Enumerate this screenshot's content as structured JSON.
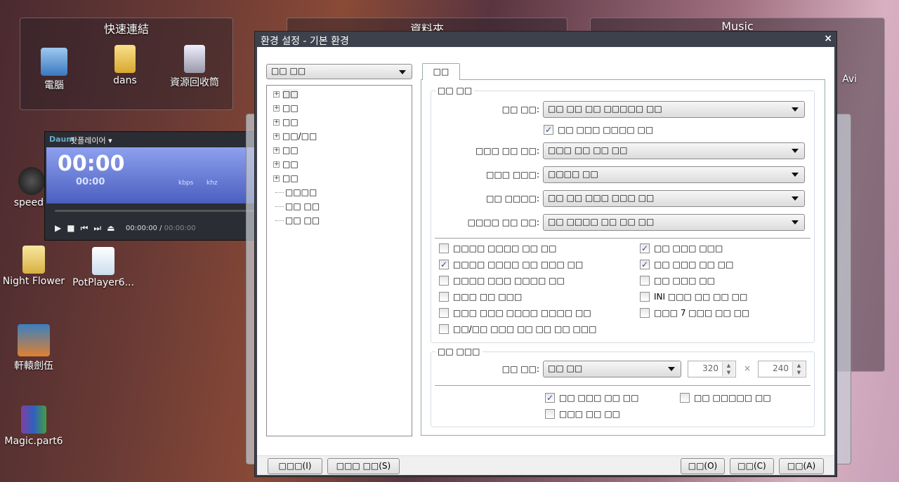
{
  "desktop": {
    "fences": [
      {
        "title": "快速連結"
      },
      {
        "title": "資料夾"
      },
      {
        "title": "Music"
      }
    ],
    "fence_icons": [
      {
        "label": "電腦",
        "icon": "computer-icon"
      },
      {
        "label": "dans",
        "icon": "user-folder-icon"
      },
      {
        "label": "資源回收筒",
        "icon": "recycle-bin-icon"
      },
      {
        "label": "Avi",
        "icon": "folder-icon"
      }
    ],
    "icons": [
      {
        "label": "speedy",
        "icon": "speedometer-icon"
      },
      {
        "label": "Night Flower",
        "icon": "folder-icon"
      },
      {
        "label": "PotPlayer6...",
        "icon": "settings-file-icon"
      },
      {
        "label": "軒轅劍伍",
        "icon": "game-icon"
      },
      {
        "label": "Magic.part6",
        "icon": "winrar-icon"
      }
    ]
  },
  "potplayer": {
    "brand": "Daum",
    "title": "팟플레이어",
    "time_big": "00:00",
    "time_small": "00:00",
    "kbps": "kbps",
    "khz": "khz",
    "position": "00:00:00",
    "separator": "/",
    "duration": "00:00:00"
  },
  "dialog": {
    "title": "환경 설정 - 기본 환경",
    "close": "×",
    "left_combo": "□□ □□",
    "tree": [
      {
        "label": "□□",
        "expandable": true
      },
      {
        "label": "□□",
        "expandable": true
      },
      {
        "label": "□□",
        "expandable": true
      },
      {
        "label": "□□/□□",
        "expandable": true
      },
      {
        "label": "□□",
        "expandable": true
      },
      {
        "label": "□□",
        "expandable": true
      },
      {
        "label": "□□",
        "expandable": true
      },
      {
        "label": "□□□□",
        "expandable": false
      },
      {
        "label": "□□ □□",
        "expandable": false
      },
      {
        "label": "□□ □□",
        "expandable": false
      }
    ],
    "tab": "□□",
    "group1": {
      "label": "□□ □□",
      "rows": [
        {
          "label": "□□ □□:",
          "value": "□□ □□ □□ □□□□□ □□"
        },
        {
          "label": "□□□ □□ □□:",
          "value": "□□□ □□ □□ □□"
        },
        {
          "label": "□□□ □□□:",
          "value": "□□□□ □□"
        },
        {
          "label": "□□ □□□□:",
          "value": "□□ □□ □□□ □□□ □□"
        },
        {
          "label": "□□□□ □□ □□:",
          "value": "□□ □□□□ □□ □□ □□"
        }
      ],
      "inline_check": {
        "label": "□□ □□□ □□□□ □□",
        "checked": true
      },
      "checks_left": [
        {
          "label": "□□□□ □□□□ □□ □□",
          "checked": false
        },
        {
          "label": "□□□□ □□□□ □□ □□□ □□",
          "checked": true
        },
        {
          "label": "□□□□ □□□ □□□□ □□",
          "checked": false
        },
        {
          "label": "□□□ □□ □□□",
          "checked": false
        },
        {
          "label": "□□□ □□□ □□□□ □□□□ □□",
          "checked": false
        },
        {
          "label": "□□/□□ □□□ □□ □□ □□ □□□",
          "checked": false
        }
      ],
      "checks_right": [
        {
          "label": "□□ □□□ □□□",
          "checked": true
        },
        {
          "label": "□□ □□□ □□ □□",
          "checked": true
        },
        {
          "label": "□□ □□□ □□",
          "checked": false
        },
        {
          "label": "INI □□□ □□ □□ □□",
          "checked": false
        },
        {
          "label": "□□□ 7 □□□ □□ □□",
          "checked": false
        }
      ]
    },
    "group2": {
      "label": "□□ □□□",
      "size_label": "□□ □□:",
      "size_value": "□□ □□",
      "width": "320",
      "times": "×",
      "height": "240",
      "checks": [
        {
          "label": "□□ □□□ □□ □□",
          "checked": true
        },
        {
          "label": "□□ □□□□□ □□",
          "checked": false
        },
        {
          "label": "□□□ □□ □□",
          "checked": false
        }
      ]
    },
    "buttons": {
      "import": "□□□(I)",
      "export": "□□□ □□(S)",
      "ok": "□□(O)",
      "cancel": "□□(C)",
      "apply": "□□(A)"
    }
  }
}
